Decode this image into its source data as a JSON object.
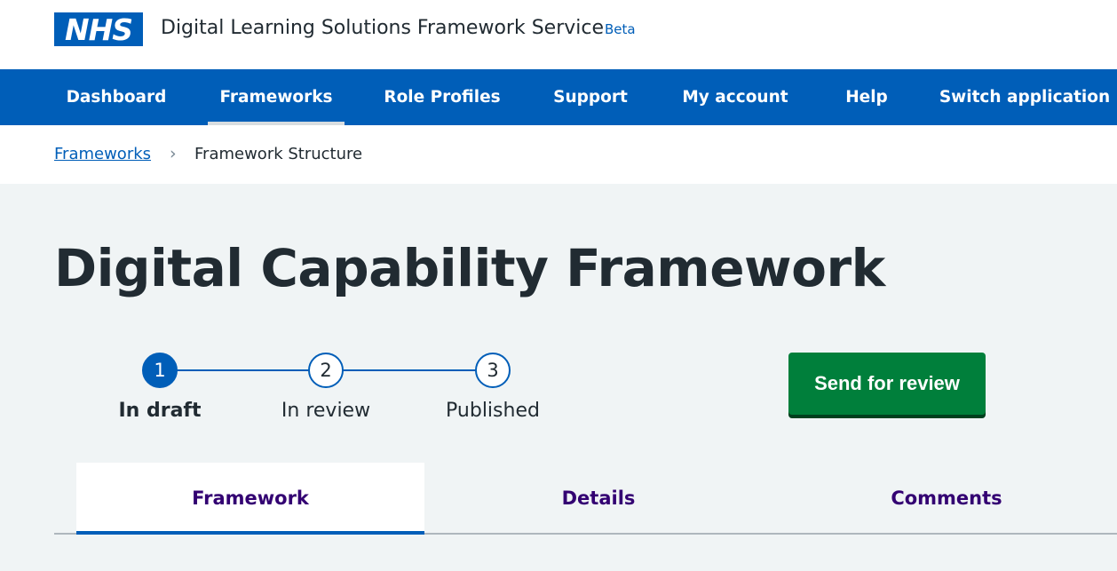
{
  "header": {
    "logo_text": "NHS",
    "service_name": "Digital Learning Solutions Framework Service",
    "beta_tag": "Beta"
  },
  "nav": {
    "items": [
      {
        "label": "Dashboard"
      },
      {
        "label": "Frameworks",
        "active": true
      },
      {
        "label": "Role Profiles"
      },
      {
        "label": "Support"
      },
      {
        "label": "My account"
      },
      {
        "label": "Help"
      },
      {
        "label": "Switch application"
      }
    ]
  },
  "breadcrumb": {
    "link": "Frameworks",
    "separator": "›",
    "current": "Framework Structure"
  },
  "page": {
    "title": "Digital Capability Framework"
  },
  "progress": {
    "steps": [
      {
        "number": "1",
        "label": "In draft",
        "active": true
      },
      {
        "number": "2",
        "label": "In review"
      },
      {
        "number": "3",
        "label": "Published"
      }
    ]
  },
  "actions": {
    "send_for_review": "Send for review"
  },
  "tabs": [
    {
      "label": "Framework",
      "active": true
    },
    {
      "label": "Details"
    },
    {
      "label": "Comments"
    }
  ],
  "colors": {
    "nhs_blue": "#005eb8",
    "button_green": "#007f3b",
    "tab_text": "#330072",
    "page_bg": "#f0f4f5"
  }
}
